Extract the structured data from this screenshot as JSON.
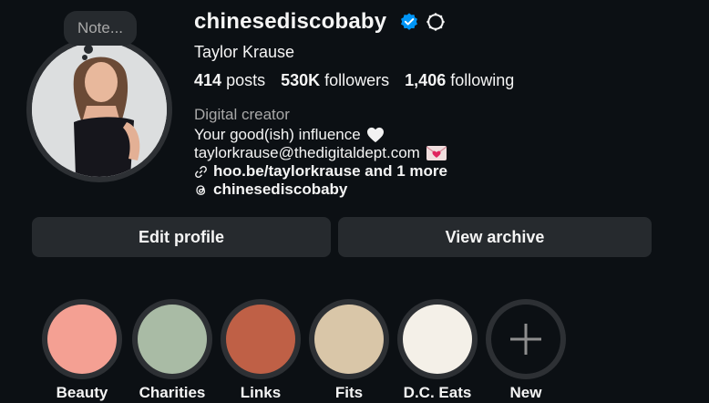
{
  "profile": {
    "note": "Note...",
    "username": "chinesediscobaby",
    "full_name": "Taylor Krause",
    "stats": {
      "posts_count": "414",
      "posts_label": "posts",
      "followers_count": "530K",
      "followers_label": "followers",
      "following_count": "1,406",
      "following_label": "following"
    },
    "category": "Digital creator",
    "bio": {
      "line1": "Your good(ish) influence",
      "line2": "taylorkrause@thedigitaldept.com",
      "link": "hoo.be/taylorkrause and 1 more",
      "threads": "chinesediscobaby"
    }
  },
  "actions": {
    "edit_profile": "Edit profile",
    "view_archive": "View archive"
  },
  "highlights": [
    {
      "label": "Beauty",
      "color": "#f4a093"
    },
    {
      "label": "Charities",
      "color": "#a9bba5"
    },
    {
      "label": "Links",
      "color": "#bf6046"
    },
    {
      "label": "Fits",
      "color": "#d9c6a8"
    },
    {
      "label": "D.C. Eats",
      "color": "#f4f0e8"
    },
    {
      "label": "New",
      "icon": "plus-icon"
    }
  ],
  "colors": {
    "background": "#0c1014",
    "button": "#262a2e",
    "verified": "#0095f6",
    "muted_text": "#a8a8a8"
  }
}
